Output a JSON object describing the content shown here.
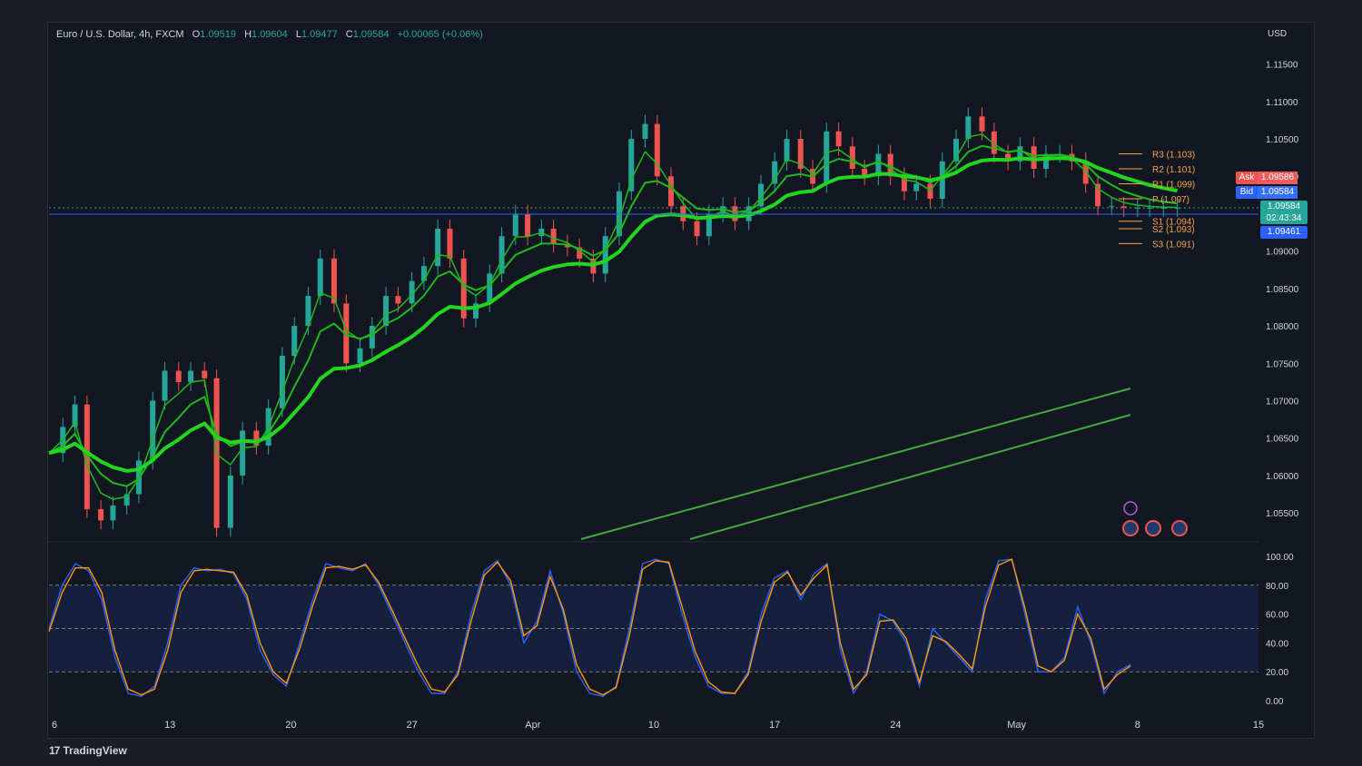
{
  "header": {
    "symbol": "Euro / U.S. Dollar, 4h, FXCM",
    "o_label": "O",
    "o_value": "1.09519",
    "h_label": "H",
    "h_value": "1.09604",
    "l_label": "L",
    "l_value": "1.09477",
    "c_label": "C",
    "c_value": "1.09584",
    "change": "+0.00065 (+0.06%)"
  },
  "currency_label": "USD",
  "branding": {
    "logo_mark": "17",
    "name": "TradingView"
  },
  "price_tags": {
    "ask_label": "Ask",
    "ask_value": "1.09586",
    "bid_label": "Bid",
    "bid_value": "1.09584",
    "last_value": "1.09584",
    "countdown": "02:43:34",
    "line_value": "1.09461"
  },
  "colors": {
    "up": "#26a69a",
    "down": "#ef5350",
    "ema_strong": "#22d61f",
    "ema_mid": "#1fb81d",
    "ema_red": "#d91a1a",
    "pivot": "#f7a24a",
    "stoch_k": "#2962ff",
    "stoch_d": "#ff9800",
    "channel": "#3fa83f"
  },
  "chart_data": [
    {
      "type": "candlestick",
      "price_axis": {
        "min": 1.0515,
        "max": 1.1175,
        "ticks": [
          "1.11500",
          "1.11000",
          "1.10500",
          "1.10000",
          "1.09500",
          "1.09000",
          "1.08500",
          "1.08000",
          "1.07500",
          "1.07000",
          "1.06500",
          "1.06000",
          "1.05500"
        ]
      },
      "time_axis": {
        "labels": [
          "6",
          "13",
          "20",
          "27",
          "Apr",
          "10",
          "17",
          "24",
          "May",
          "8",
          "15"
        ]
      },
      "series": [
        {
          "name": "price",
          "x_days": [
            0,
            0.8,
            1.5,
            2.2,
            3,
            3.7,
            4.5,
            5.2,
            6,
            6.7,
            7.5,
            8.2,
            9,
            9.7,
            10.5,
            11.2,
            12,
            12.7,
            13.5,
            14.2,
            15,
            15.7,
            16.5,
            17.2,
            18,
            18.7,
            19.5,
            20.2,
            21,
            21.7,
            22.5,
            23.2,
            24,
            24.7,
            25.5,
            26.2,
            27,
            27.7,
            28.5,
            29.2,
            30,
            30.7,
            31.5,
            32.2,
            33,
            33.7,
            34.5,
            35.2,
            36,
            36.7,
            37.5,
            38.2,
            39,
            39.7,
            40.5,
            41.2,
            42,
            42.7,
            43.5,
            44.2,
            45,
            45.7,
            46.5,
            47.2,
            48,
            48.7,
            49.5,
            50.2,
            51,
            51.7,
            52.5,
            53.2,
            54,
            54.7,
            55.5,
            56.2,
            57,
            57.7,
            58.5,
            59.2,
            60,
            60.7,
            61.5,
            62.2,
            63,
            63.7,
            64.5,
            65.3
          ],
          "close": [
            1.063,
            1.0665,
            1.0695,
            1.0555,
            1.054,
            1.056,
            1.0575,
            1.062,
            1.07,
            1.074,
            1.0725,
            1.074,
            1.073,
            1.053,
            1.06,
            1.066,
            1.064,
            1.069,
            1.076,
            1.08,
            1.084,
            1.089,
            1.083,
            1.075,
            1.077,
            1.08,
            1.084,
            1.083,
            1.086,
            1.088,
            1.093,
            1.089,
            1.081,
            1.083,
            1.087,
            1.092,
            1.095,
            1.092,
            1.093,
            1.091,
            1.0905,
            1.089,
            1.087,
            1.092,
            1.098,
            1.105,
            1.107,
            1.1,
            1.096,
            1.094,
            1.092,
            1.095,
            1.096,
            1.094,
            1.096,
            1.099,
            1.102,
            1.105,
            1.101,
            1.099,
            1.106,
            1.104,
            1.101,
            1.1,
            1.103,
            1.1,
            1.098,
            1.099,
            1.097,
            1.102,
            1.105,
            1.108,
            1.106,
            1.103,
            1.102,
            1.104,
            1.101,
            1.103,
            1.103,
            1.102,
            1.099,
            1.096,
            1.096,
            1.0958,
            1.0958,
            1.0958,
            1.0958,
            1.0958
          ]
        },
        {
          "name": "R3 (1.103)",
          "value": 1.103
        },
        {
          "name": "R2 (1.101)",
          "value": 1.101
        },
        {
          "name": "R1 (1.099)",
          "value": 1.099
        },
        {
          "name": "P (1.097)",
          "value": 1.097
        },
        {
          "name": "S1 (1.094)",
          "value": 1.094
        },
        {
          "name": "S2 (1.093)",
          "value": 1.093
        },
        {
          "name": "S3 (1.091)",
          "value": 1.091
        }
      ],
      "xlim_days": [
        0,
        70
      ]
    },
    {
      "type": "line",
      "name": "stochastic",
      "y_axis": {
        "min": 0,
        "max": 100,
        "ticks": [
          "100.00",
          "80.00",
          "60.00",
          "40.00",
          "20.00",
          "0.00"
        ]
      },
      "bands": {
        "upper": 80,
        "middle": 50,
        "lower": 20
      },
      "series": [
        {
          "key": "k",
          "values": [
            50,
            80,
            95,
            90,
            70,
            30,
            5,
            3,
            10,
            40,
            80,
            92,
            90,
            91,
            88,
            70,
            35,
            18,
            10,
            40,
            70,
            95,
            92,
            90,
            95,
            80,
            60,
            40,
            20,
            5,
            5,
            20,
            60,
            90,
            97,
            80,
            40,
            55,
            90,
            60,
            20,
            5,
            3,
            10,
            50,
            95,
            98,
            95,
            60,
            30,
            10,
            5,
            5,
            20,
            60,
            85,
            90,
            70,
            88,
            95,
            35,
            5,
            20,
            60,
            55,
            40,
            10,
            50,
            40,
            30,
            20,
            70,
            97,
            98,
            60,
            20,
            20,
            30,
            65,
            40,
            5,
            20,
            25
          ]
        },
        {
          "key": "d",
          "values": [
            48,
            75,
            92,
            92,
            75,
            35,
            8,
            4,
            8,
            35,
            75,
            90,
            91,
            90,
            89,
            73,
            40,
            20,
            12,
            36,
            66,
            92,
            93,
            91,
            94,
            82,
            63,
            43,
            24,
            8,
            6,
            18,
            55,
            87,
            96,
            83,
            45,
            52,
            86,
            63,
            25,
            8,
            4,
            9,
            45,
            91,
            97,
            96,
            65,
            34,
            13,
            6,
            5,
            18,
            55,
            82,
            89,
            73,
            85,
            94,
            40,
            8,
            18,
            55,
            56,
            43,
            13,
            45,
            41,
            32,
            22,
            65,
            94,
            98,
            64,
            24,
            20,
            28,
            60,
            43,
            8,
            18,
            24
          ]
        }
      ]
    }
  ]
}
